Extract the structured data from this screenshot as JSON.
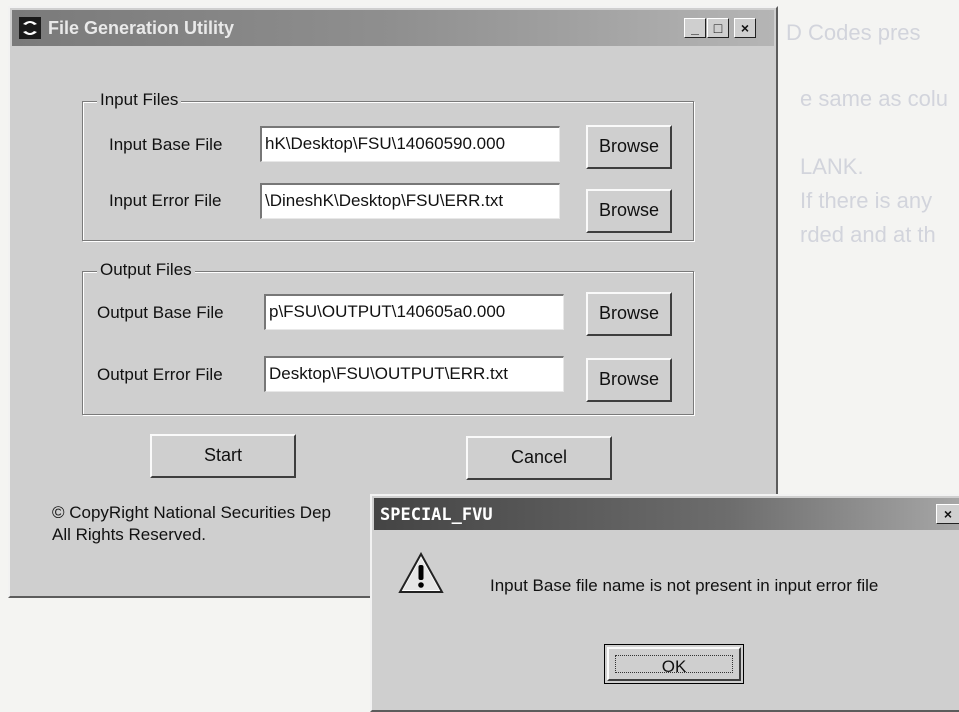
{
  "background_document": {
    "line1": "D Codes pres",
    "line2": "e same as colu",
    "line3": "LANK.",
    "line4": "If there is any",
    "line5": "rded and at th"
  },
  "main_window": {
    "title": "File Generation Utility",
    "icon": "fsu-app-icon",
    "title_buttons": {
      "minimize": "_",
      "maximize": "□",
      "close": "×"
    },
    "input_group": {
      "label": "Input Files",
      "rows": [
        {
          "label": "Input Base File",
          "value": "hK\\Desktop\\FSU\\14060590.000",
          "button": "Browse"
        },
        {
          "label": "Input Error File",
          "value": "\\DineshK\\Desktop\\FSU\\ERR.txt",
          "button": "Browse"
        }
      ]
    },
    "output_group": {
      "label": "Output Files",
      "rows": [
        {
          "label": "Output Base File",
          "value": "p\\FSU\\OUTPUT\\140605a0.000",
          "button": "Browse"
        },
        {
          "label": "Output Error File",
          "value": "Desktop\\FSU\\OUTPUT\\ERR.txt",
          "button": "Browse"
        }
      ]
    },
    "start_label": "Start",
    "cancel_label": "Cancel",
    "copyright_line1": "© CopyRight National Securities Dep",
    "copyright_line2": "All Rights Reserved."
  },
  "dialog": {
    "title": "SPECIAL_FVU",
    "close": "×",
    "icon": "warning-icon",
    "message": "Input Base file name is not present in input error file",
    "ok_label": "OK"
  }
}
